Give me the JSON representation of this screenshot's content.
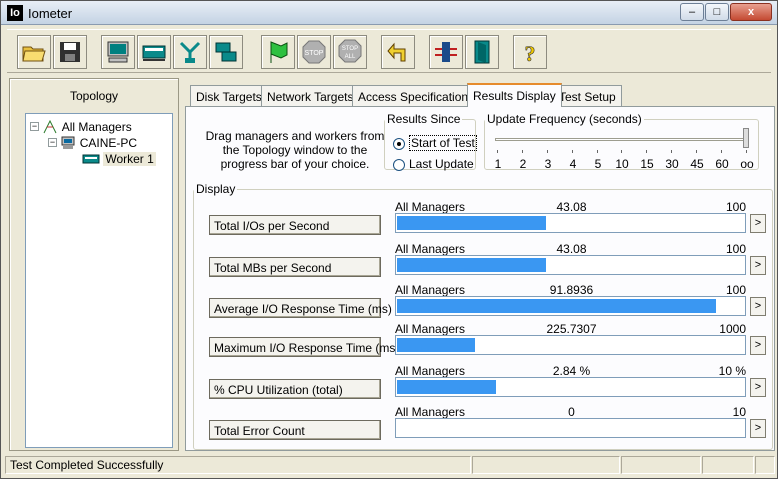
{
  "window": {
    "app_icon": "Io",
    "title": "Iometer",
    "min": "–",
    "max": "□",
    "close": "x"
  },
  "toolbar": {
    "buttons": [
      {
        "name": "open-icon"
      },
      {
        "name": "save-icon"
      },
      {
        "name": "display-icon"
      },
      {
        "name": "new-manager-icon"
      },
      {
        "name": "new-network-worker-icon"
      },
      {
        "name": "duplicate-worker-icon"
      },
      {
        "name": "start-flag-icon"
      },
      {
        "name": "stop-icon",
        "label": "STOP"
      },
      {
        "name": "stop-all-icon",
        "label": "STOP ALL"
      },
      {
        "name": "reset-icon"
      },
      {
        "name": "disconnect-icon"
      },
      {
        "name": "exit-icon"
      },
      {
        "name": "help-icon",
        "label": "?"
      }
    ]
  },
  "topology": {
    "title": "Topology",
    "tree": [
      {
        "label": "All Managers",
        "expander": "−"
      },
      {
        "label": "CAINE-PC",
        "expander": "−"
      },
      {
        "label": "Worker 1"
      }
    ]
  },
  "tabs": [
    "Disk Targets",
    "Network Targets",
    "Access Specifications",
    "Results Display",
    "Test Setup"
  ],
  "active_tab": "Results Display",
  "instructions": "Drag managers and workers from the Topology window to the progress bar of your choice.",
  "results_since": {
    "legend": "Results Since",
    "options": [
      "Start of Test",
      "Last Update"
    ],
    "selected": "Start of Test"
  },
  "update_frequency": {
    "legend": "Update Frequency (seconds)",
    "ticks": [
      "1",
      "2",
      "3",
      "4",
      "5",
      "10",
      "15",
      "30",
      "45",
      "60",
      "oo"
    ],
    "selected": "oo"
  },
  "display": {
    "legend": "Display",
    "metrics": [
      {
        "name": "Total I/Os per Second",
        "source": "All Managers",
        "value": "43.08",
        "max": "100",
        "fill": 0.43
      },
      {
        "name": "Total MBs per Second",
        "source": "All Managers",
        "value": "43.08",
        "max": "100",
        "fill": 0.43
      },
      {
        "name": "Average I/O Response Time (ms)",
        "source": "All Managers",
        "value": "91.8936",
        "max": "100",
        "fill": 0.919
      },
      {
        "name": "Maximum I/O Response Time (ms)",
        "source": "All Managers",
        "value": "225.7307",
        "max": "1000",
        "fill": 0.226
      },
      {
        "name": "% CPU Utilization (total)",
        "source": "All Managers",
        "value": "2.84 %",
        "max": "10 %",
        "fill": 0.284
      },
      {
        "name": "Total Error Count",
        "source": "All Managers",
        "value": "0",
        "max": "10",
        "fill": 0
      }
    ],
    "arrow": ">"
  },
  "status": {
    "message": "Test Completed Successfully"
  },
  "colors": {
    "bar_fill": "#3a97f2",
    "active_tab_accent": "#e68b2c"
  }
}
